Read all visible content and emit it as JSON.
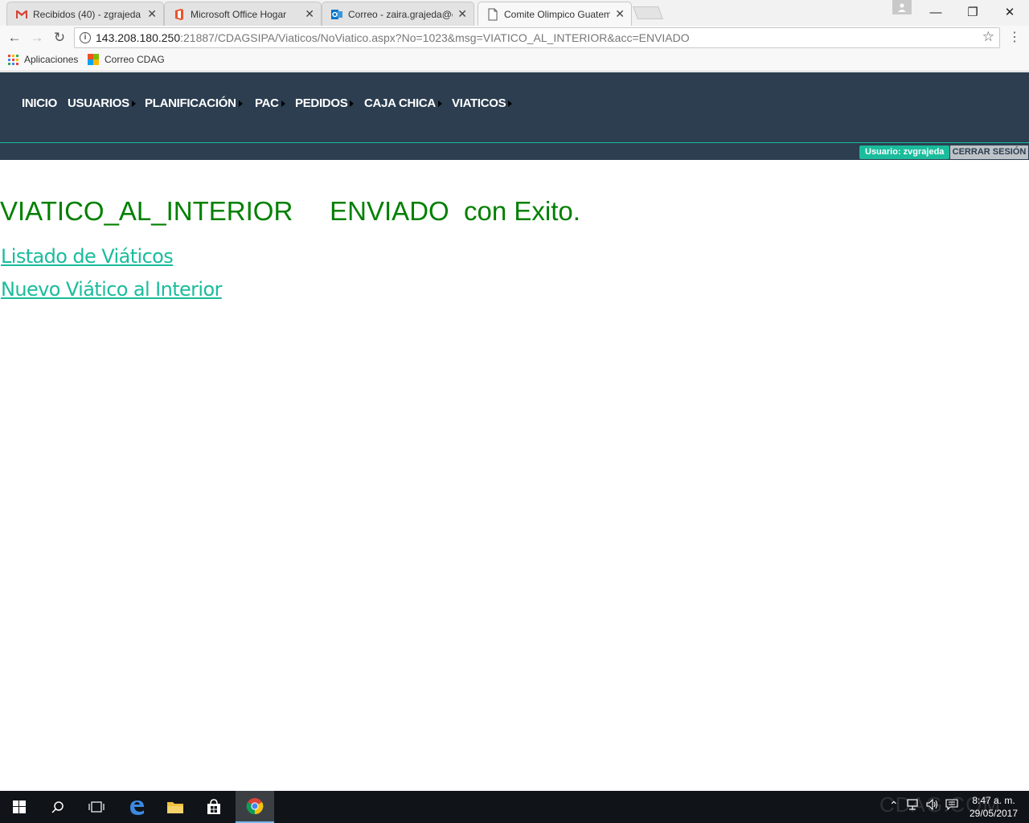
{
  "browser": {
    "tabs": [
      {
        "title": "Recibidos (40) - zgrajeda",
        "icon": "gmail-icon"
      },
      {
        "title": "Microsoft Office Hogar",
        "icon": "office-icon"
      },
      {
        "title": "Correo - zaira.grajeda@c",
        "icon": "outlook-icon"
      },
      {
        "title": "Comite Olimpico Guatem",
        "icon": "page-icon"
      }
    ],
    "url_host": "143.208.180.250",
    "url_rest": ":21887/CDAGSIPA/Viaticos/NoViatico.aspx?No=1023&msg=VIATICO_AL_INTERIOR&acc=ENVIADO",
    "bookmarks": [
      "Aplicaciones",
      "Correo CDAG"
    ]
  },
  "site": {
    "nav": [
      "INICIO",
      "USUARIOS",
      "PLANIFICACIÓN",
      "PAC",
      "PEDIDOS",
      "CAJA CHICA",
      "VIATICOS"
    ],
    "user_label": "Usuario: zvgrajeda",
    "logout_label": "CERRAR SESIÓN"
  },
  "content": {
    "message_type": "VIATICO_AL_INTERIOR",
    "message_action": "ENVIADO",
    "message_suffix": "con Exito.",
    "links": [
      "Listado de Viáticos",
      "Nuevo Viático al Interior"
    ]
  },
  "taskbar": {
    "time": "8:47 a. m.",
    "date": "29/05/2017",
    "watermark": "CDAG.COM"
  },
  "colors": {
    "header_bg": "#2c3e50",
    "accent": "#1abc9c",
    "success": "#008000"
  }
}
